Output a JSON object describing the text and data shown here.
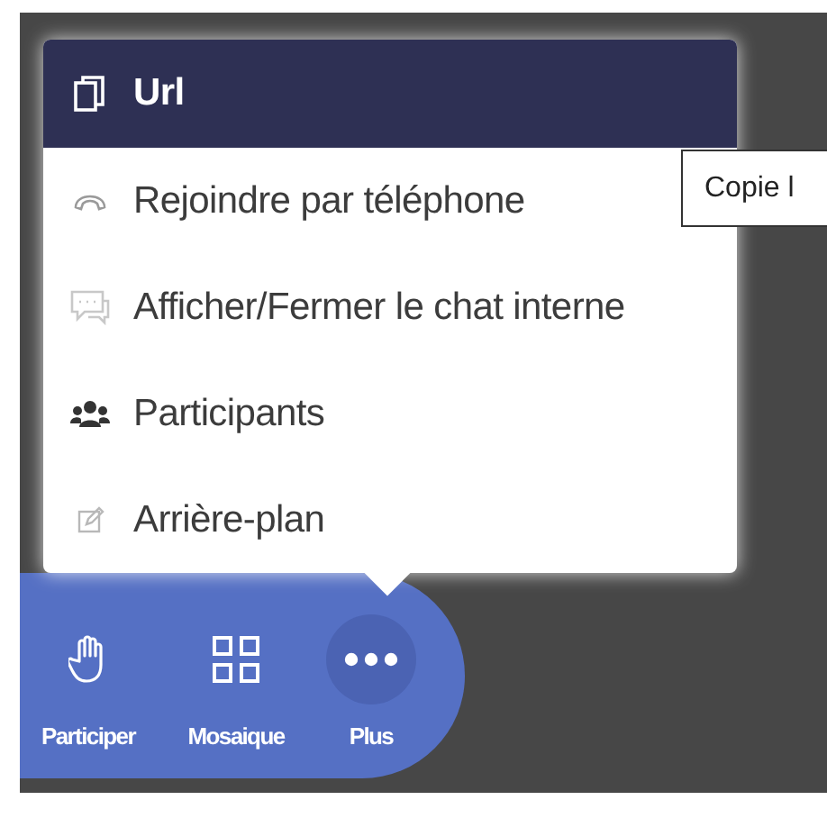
{
  "menu": {
    "items": [
      {
        "label": "Url",
        "kind": "copy",
        "selected": true
      },
      {
        "label": "Rejoindre par téléphone",
        "kind": "phone",
        "selected": false
      },
      {
        "label": "Afficher/Fermer le chat interne",
        "kind": "chat",
        "selected": false
      },
      {
        "label": "Participants",
        "kind": "users",
        "selected": false
      },
      {
        "label": "Arrière-plan",
        "kind": "edit",
        "selected": false
      }
    ]
  },
  "tooltip": {
    "text": "Copie l"
  },
  "toolbar": {
    "items": [
      {
        "label": "Participer",
        "kind": "hand",
        "selected": false
      },
      {
        "label": "Mosaique",
        "kind": "grid",
        "selected": false
      },
      {
        "label": "Plus",
        "kind": "dots",
        "selected": true
      }
    ]
  }
}
